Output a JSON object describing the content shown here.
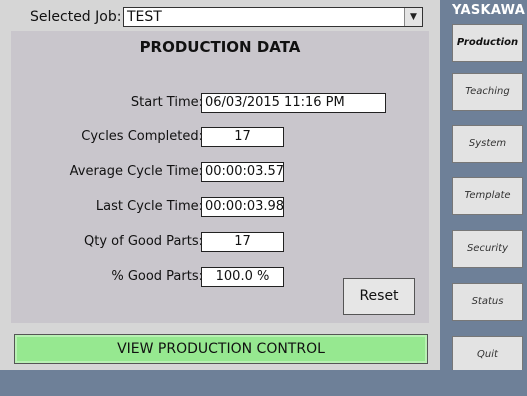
{
  "header": {
    "job_label": "Selected Job:",
    "job_value": "TEST",
    "dropdown_icon": "chevron-down-icon"
  },
  "panel": {
    "title": "PRODUCTION DATA",
    "fields": [
      {
        "label": "Start Time:",
        "value": "06/03/2015 11:16 PM"
      },
      {
        "label": "Cycles Completed:",
        "value": "17"
      },
      {
        "label": "Average Cycle Time:",
        "value": "00:00:03.57"
      },
      {
        "label": "Last Cycle Time:",
        "value": "00:00:03.98"
      },
      {
        "label": "Qty of Good Parts:",
        "value": "17"
      },
      {
        "label": "% Good Parts:",
        "value": "100.0 %"
      }
    ],
    "reset_label": "Reset"
  },
  "footer": {
    "view_control_label": "VIEW PRODUCTION CONTROL"
  },
  "sidebar": {
    "brand": "YASKAWA",
    "items": [
      {
        "label": "Production",
        "active": true
      },
      {
        "label": "Teaching"
      },
      {
        "label": "System"
      },
      {
        "label": "Template"
      },
      {
        "label": "Security"
      },
      {
        "label": "Status"
      },
      {
        "label": "Quit"
      }
    ]
  },
  "colors": {
    "background": "#6e8098",
    "panel": "#c9c6cc",
    "green_button": "#96e890"
  }
}
